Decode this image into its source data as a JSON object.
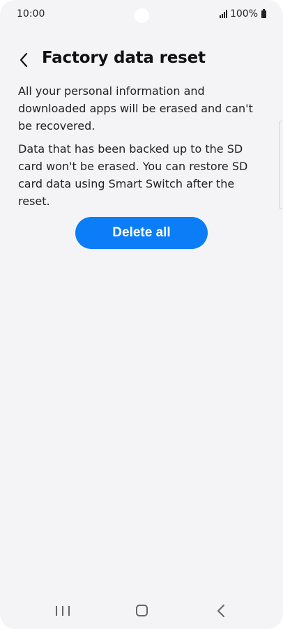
{
  "status_bar": {
    "time": "10:00",
    "battery": "100%"
  },
  "header": {
    "title": "Factory data reset"
  },
  "content": {
    "paragraph_1": "All your personal information and downloaded apps will be erased and can't be recovered.",
    "paragraph_2": "Data that has been backed up to the SD card won't be erased. You can restore SD card data using Smart Switch after the reset."
  },
  "actions": {
    "delete_all_label": "Delete all"
  },
  "colors": {
    "accent": "#0a7df7",
    "background": "#f4f4f6"
  },
  "icons": {
    "back": "chevron-left-icon",
    "signal": "signal-icon",
    "battery": "battery-icon",
    "nav_recents": "recents-icon",
    "nav_home": "home-icon",
    "nav_back": "back-icon"
  }
}
